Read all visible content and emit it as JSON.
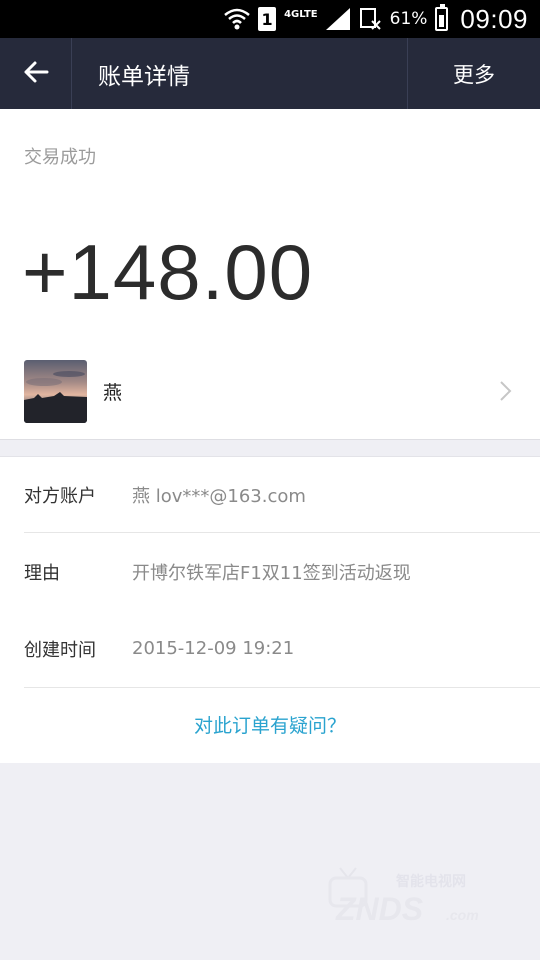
{
  "status_bar": {
    "sim": "1",
    "network": "4GLTE",
    "battery": "61%",
    "time": "09:09"
  },
  "header": {
    "title": "账单详情",
    "more_label": "更多"
  },
  "summary": {
    "status": "交易成功",
    "amount": "+148.00",
    "counterparty_name": "燕"
  },
  "details": {
    "rows": [
      {
        "label": "对方账户",
        "value": "燕 lov***@163.com"
      },
      {
        "label": "理由",
        "value": "开博尔铁军店F1双11签到活动返现"
      },
      {
        "label": "创建时间",
        "value": "2015-12-09 19:21"
      }
    ],
    "question_link": "对此订单有疑问？"
  },
  "watermark": {
    "cn": "智能电视网",
    "en": "ZNDS",
    "suffix": ".com"
  },
  "colors": {
    "header_bg": "#262a3b",
    "link": "#2aa3cf",
    "page_bg": "#efeff4"
  }
}
